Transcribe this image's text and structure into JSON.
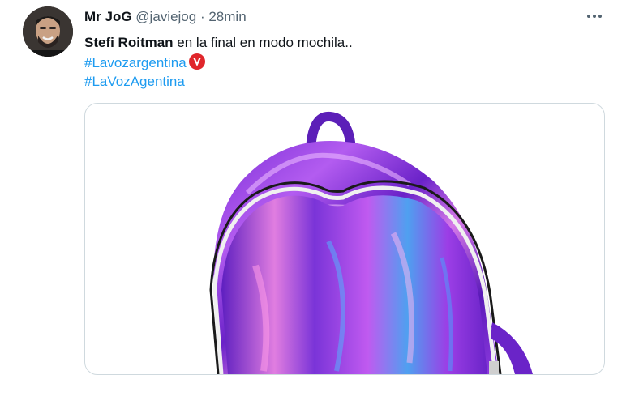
{
  "tweet": {
    "display_name": "Mr JoG",
    "handle": "@javiejog",
    "separator": "·",
    "time": "28min",
    "more_icon": "more-horizontal-icon",
    "mention": "Stefi Roitman",
    "text_rest": " en la final en modo mochila..",
    "hashtag1": "#Lavozargentina",
    "hashtag2": "#LaVozAgentina",
    "hashtag_color": "#1d9bf0",
    "emoji_icon": "la-voz-v-badge-icon",
    "media": "purple-holographic-backpack-photo"
  }
}
